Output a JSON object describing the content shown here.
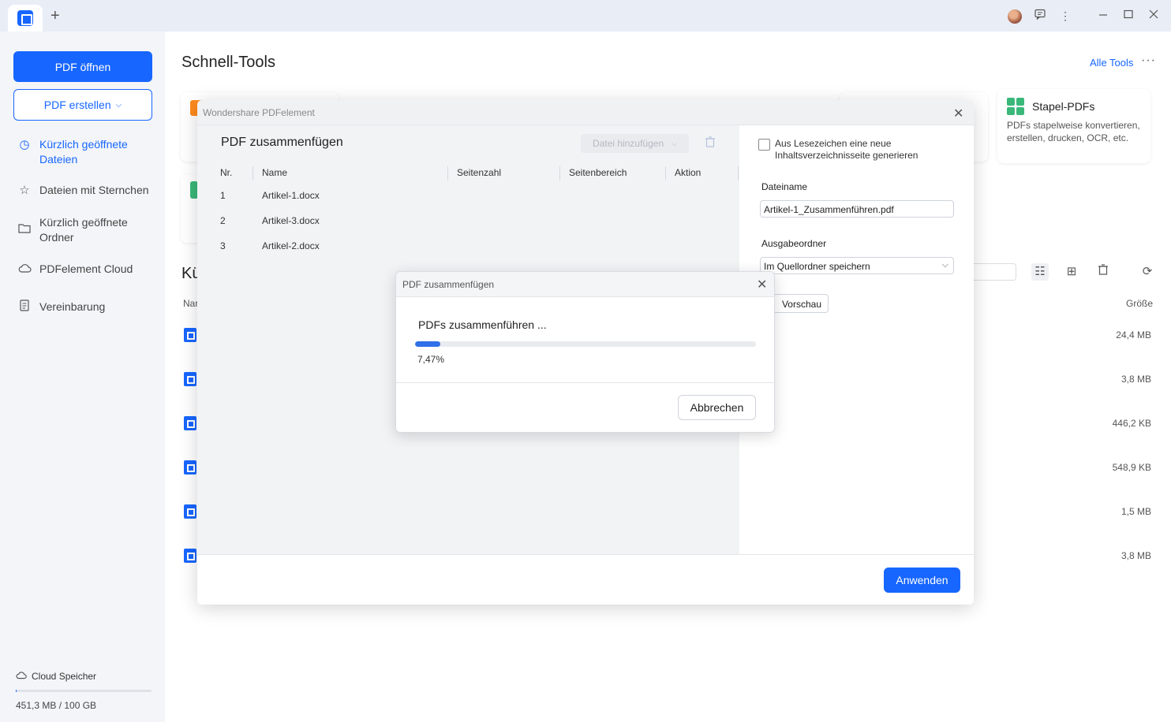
{
  "titlebar": {
    "newtab_icon": "+",
    "icons": [
      "avatar",
      "chat-icon",
      "more-vertical-icon",
      "minimize-icon",
      "maximize-icon",
      "close-icon"
    ]
  },
  "sidebar": {
    "open_pdf": "PDF öffnen",
    "create_pdf": "PDF erstellen",
    "items": [
      {
        "label": "Kürzlich geöffnete Dateien",
        "icon": "clock-icon",
        "active": true
      },
      {
        "label": "Dateien mit Sternchen",
        "icon": "star-icon",
        "active": false
      },
      {
        "label": "Kürzlich geöffnete Ordner",
        "icon": "folder-icon",
        "active": false
      },
      {
        "label": "PDFelement Cloud",
        "icon": "cloud-icon",
        "active": false
      },
      {
        "label": "Vereinbarung",
        "icon": "document-icon",
        "active": false
      }
    ],
    "cloud_label": "Cloud Speicher",
    "storage_text": "451,3 MB / 100 GB",
    "storage_used_fraction": 0.0045
  },
  "main": {
    "title": "Schnell-Tools",
    "all_tools": "Alle Tools",
    "cards": [
      {
        "title": "Stapel-PDFs",
        "desc": "PDFs stapelweise konvertieren, erstellen, drucken, OCR, etc."
      }
    ],
    "recent_title_partial": "Kü",
    "col_name_partial": "Nar",
    "col_size": "Größe",
    "file_sizes": [
      "24,4 MB",
      "3,8 MB",
      "446,2 KB",
      "548,9 KB",
      "1,5 MB",
      "3,8 MB"
    ]
  },
  "merge_dialog": {
    "window_title": "Wondershare PDFelement",
    "title": "PDF zusammenfügen",
    "add_file": "Datei hinzufügen",
    "columns": [
      "Nr.",
      "Name",
      "Seitenzahl",
      "Seitenbereich",
      "Aktion"
    ],
    "rows": [
      {
        "nr": "1",
        "name": "Artikel-1.docx"
      },
      {
        "nr": "2",
        "name": "Artikel-3.docx"
      },
      {
        "nr": "3",
        "name": "Artikel-2.docx"
      }
    ],
    "bookmark_option": "Aus Lesezeichen eine neue Inhaltsverzeichnisseite generieren",
    "filename_label": "Dateiname",
    "filename_value": "Artikel-1_Zusammenführen.pdf",
    "output_label": "Ausgabeordner",
    "output_value": "Im Quellordner speichern",
    "preview_button": "Vorschau",
    "apply_button": "Anwenden"
  },
  "progress_dialog": {
    "title": "PDF zusammenfügen",
    "message": "PDFs zusammenführen ...",
    "percent_text": "7,47%",
    "progress_fraction": 0.0747,
    "cancel_button": "Abbrechen"
  },
  "colors": {
    "accent": "#1766ff",
    "progress": "#2f6fe8"
  }
}
